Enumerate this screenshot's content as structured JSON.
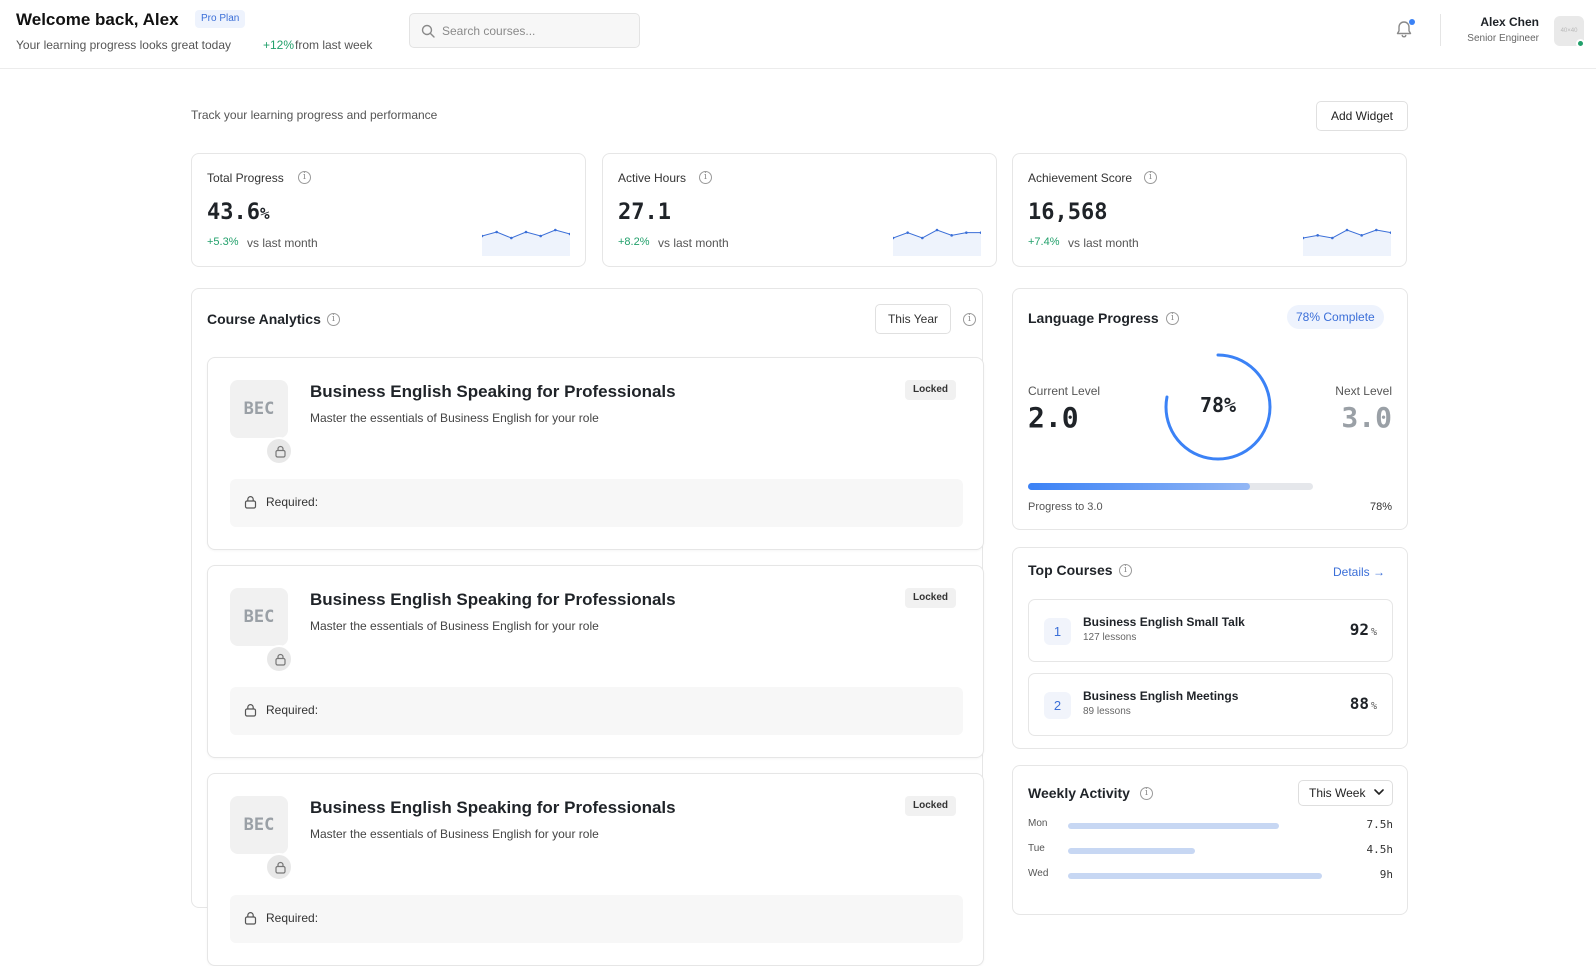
{
  "header": {
    "welcome": "Welcome back, Alex",
    "plan_badge": "Pro Plan",
    "subtitle": "Your learning progress looks great today",
    "weekly_change": "+12%",
    "weekly_change_suffix": "from last week",
    "search_placeholder": "Search courses...",
    "user_name": "Alex Chen",
    "user_role": "Senior Engineer",
    "avatar_text": "40×40",
    "notification_unread": true,
    "online_status_color": "#22a06b"
  },
  "intro": {
    "tagline": "Track your learning progress and performance",
    "add_widget_label": "Add Widget"
  },
  "stats": [
    {
      "label": "Total Progress",
      "value": "43.6",
      "unit": "%",
      "change": "+5.3%",
      "change_suffix": "vs last month",
      "trend": [
        4,
        6,
        3,
        6,
        4,
        7,
        5
      ]
    },
    {
      "label": "Active Hours",
      "value": "27.1",
      "unit": "",
      "change": "+8.2%",
      "change_suffix": "vs last month",
      "trend": [
        4,
        6,
        4,
        7,
        5,
        6,
        6
      ]
    },
    {
      "label": "Achievement Score",
      "value": "16,568",
      "unit": "",
      "change": "+7.4%",
      "change_suffix": "vs last month",
      "trend": [
        4,
        5,
        4,
        7,
        5,
        7,
        6
      ]
    }
  ],
  "analytics": {
    "title": "Course Analytics",
    "period_label": "This Year",
    "courses": [
      {
        "thumb": "BEC",
        "title": "Business English Speaking for Professionals",
        "description": "Master the essentials of Business English for your role",
        "status": "Locked",
        "requirement_label": "Required:"
      },
      {
        "thumb": "BEC",
        "title": "Business English Speaking for Professionals",
        "description": "Master the essentials of Business English for your role",
        "status": "Locked",
        "requirement_label": "Required:"
      },
      {
        "thumb": "BEC",
        "title": "Business English Speaking for Professionals",
        "description": "Master the essentials of Business English for your role",
        "status": "Locked",
        "requirement_label": "Required:"
      }
    ]
  },
  "language": {
    "title": "Language Progress",
    "complete_badge": "78% Complete",
    "current_label": "Current Level",
    "current_value": "2.0",
    "next_label": "Next Level",
    "next_value": "3.0",
    "ring_label": "78%",
    "progress": 0.78,
    "progress_label": "Progress to 3.0",
    "progress_pct": "78%"
  },
  "top_courses": {
    "title": "Top Courses",
    "details_label": "Details",
    "items": [
      {
        "rank": "1",
        "name": "Business English Small Talk",
        "lessons": "127 lessons",
        "score": "92",
        "unit": "%"
      },
      {
        "rank": "2",
        "name": "Business English Meetings",
        "lessons": "89 lessons",
        "score": "88",
        "unit": "%"
      }
    ]
  },
  "weekly": {
    "title": "Weekly Activity",
    "period_label": "This Week",
    "rows": [
      {
        "day": "Mon",
        "hours": "7.5h",
        "fraction": 0.78
      },
      {
        "day": "Tue",
        "hours": "4.5h",
        "fraction": 0.47
      },
      {
        "day": "Wed",
        "hours": "9h",
        "fraction": 0.94
      }
    ]
  },
  "colors": {
    "accent": "#3b82f6",
    "positive": "#22a06b",
    "badge_text": "#3b6fd8"
  }
}
